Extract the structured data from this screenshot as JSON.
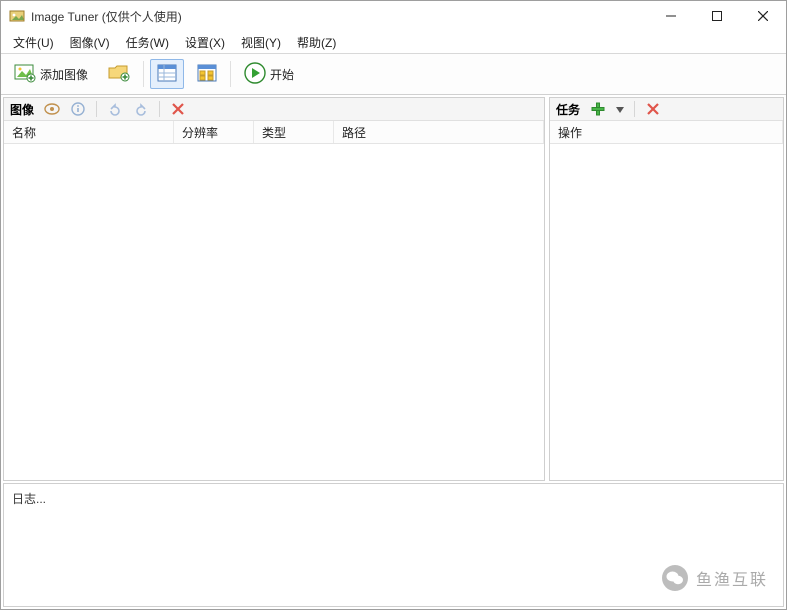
{
  "window": {
    "title": "Image Tuner (仅供个人使用)"
  },
  "menubar": {
    "items": [
      {
        "label": "文件(U)"
      },
      {
        "label": "图像(V)"
      },
      {
        "label": "任务(W)"
      },
      {
        "label": "设置(X)"
      },
      {
        "label": "视图(Y)"
      },
      {
        "label": "帮助(Z)"
      }
    ]
  },
  "toolbar": {
    "add_image_label": "添加图像",
    "start_label": "开始"
  },
  "panels": {
    "images": {
      "title": "图像",
      "columns": [
        {
          "label": "名称"
        },
        {
          "label": "分辨率"
        },
        {
          "label": "类型"
        },
        {
          "label": "路径"
        }
      ]
    },
    "tasks": {
      "title": "任务",
      "columns": [
        {
          "label": "操作"
        }
      ]
    },
    "log": {
      "title": "日志..."
    }
  },
  "watermark": {
    "text": "鱼渔互联"
  }
}
